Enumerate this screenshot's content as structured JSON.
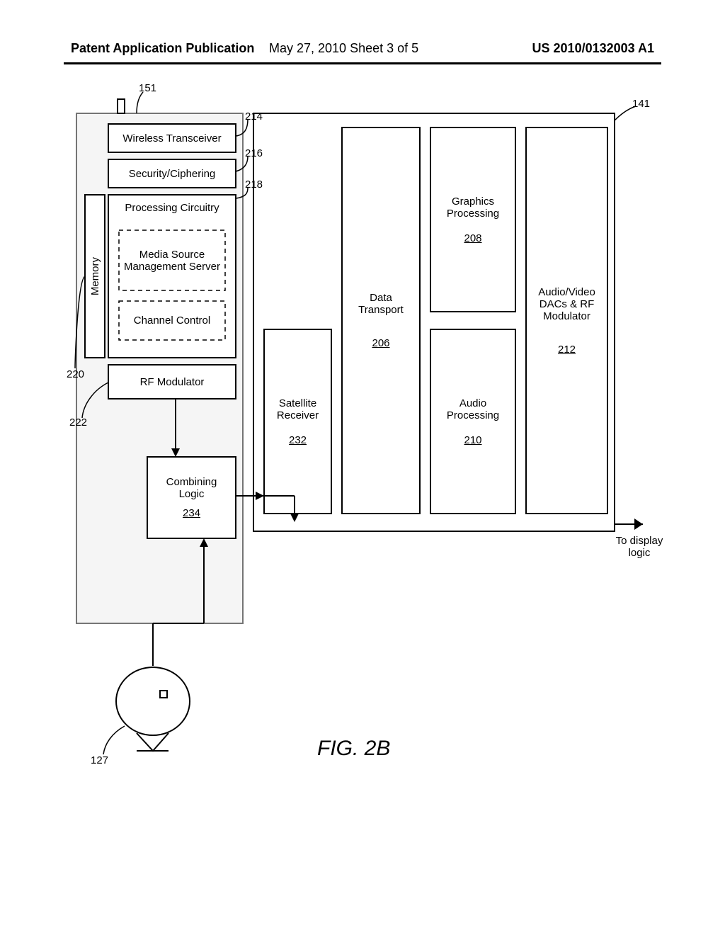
{
  "header": {
    "left": "Patent Application Publication",
    "middle": "May 27, 2010  Sheet 3 of 5",
    "right": "US 2010/0132003 A1"
  },
  "figure": {
    "label": "FIG. 2B",
    "output_arrow": "To display logic"
  },
  "blocks": {
    "main_ref": "141",
    "graphics": {
      "title1": "Graphics",
      "title2": "Processing",
      "ref": "208"
    },
    "audio": {
      "title1": "Audio",
      "title2": "Processing",
      "ref": "210"
    },
    "dac": {
      "line1": "Audio/Video",
      "line2": "DACs & RF",
      "line3": "Modulator",
      "ref": "212"
    },
    "data": {
      "title1": "Data",
      "title2": "Transport",
      "ref": "206"
    },
    "sat": {
      "title1": "Satellite",
      "title2": "Receiver",
      "ref": "232"
    },
    "left_device_ref": "151",
    "wireless": {
      "label": "Wireless Transceiver",
      "ref": "214"
    },
    "security": {
      "label": "Security/Ciphering",
      "ref": "216"
    },
    "proc": {
      "label": "Processing Circuitry",
      "ref": "218",
      "media1": "Media Source",
      "media2": "Management Server",
      "channel": "Channel Control"
    },
    "memory": {
      "label": "Memory",
      "ref": "220"
    },
    "rfmod": {
      "label": "RF Modulator",
      "ref": "222"
    },
    "combining": {
      "line1": "Combining",
      "line2": "Logic",
      "ref": "234"
    },
    "dish_ref": "127"
  }
}
